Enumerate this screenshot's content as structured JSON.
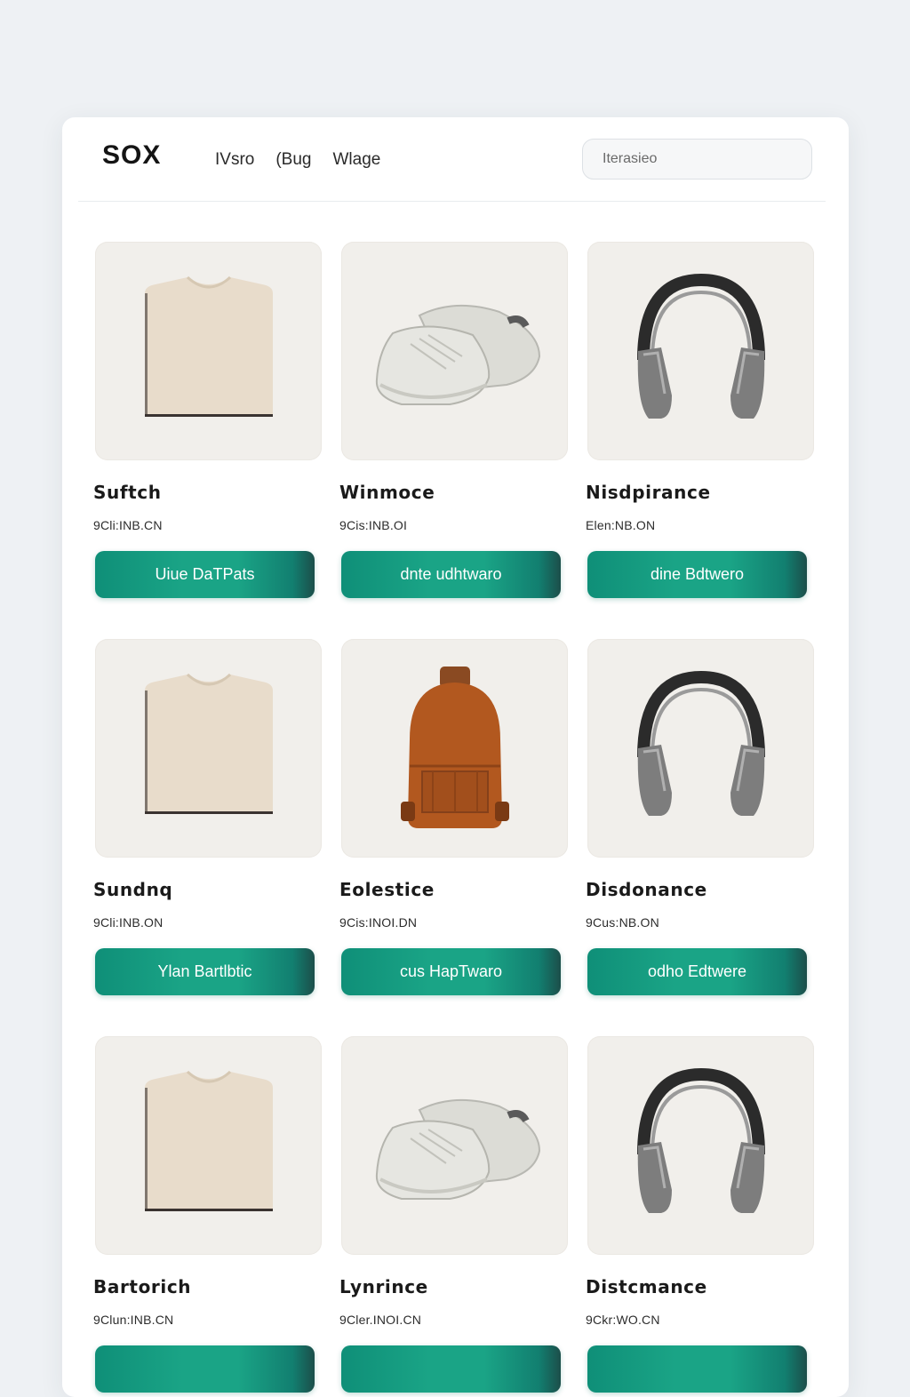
{
  "header": {
    "brand": "SOX",
    "nav": [
      "IVsro",
      "(Bug",
      "Wlage"
    ],
    "search_placeholder": "Iterasieo"
  },
  "products": [
    {
      "name": "Suftch",
      "price": "9Cli:INB.CN",
      "button": "Uiue DaTPats",
      "image": "tshirt-image"
    },
    {
      "name": "Winmoce",
      "price": "9Cis:INB.OI",
      "button": "dnte udhtwaro",
      "image": "sneakers-image"
    },
    {
      "name": "Nisdpirance",
      "price": "Elen:NB.ON",
      "button": "dine Bdtwero",
      "image": "headphones-image"
    },
    {
      "name": "Sundnq",
      "price": "9Cli:INB.ON",
      "button": "Ylan Bartlbtic",
      "image": "tshirt-image"
    },
    {
      "name": "Eolestice",
      "price": "9Cis:INOI.DN",
      "button": "cus HapTwaro",
      "image": "backpack-image"
    },
    {
      "name": "Disdonance",
      "price": "9Cus:NB.ON",
      "button": "odho Edtwere",
      "image": "headphones-image"
    },
    {
      "name": "Bartorich",
      "price": "9Clun:INB.CN",
      "button": "",
      "image": "tshirt-image"
    },
    {
      "name": "Lynrince",
      "price": "9Cler.INOI.CN",
      "button": "",
      "image": "sneakers-image"
    },
    {
      "name": "Distcmance",
      "price": "9Ckr:WO.CN",
      "button": "",
      "image": "headphones-image"
    }
  ],
  "colors": {
    "accent": "#1aa486",
    "accent_dark": "#1c4e4a",
    "photo_bg": "#f1efeb"
  }
}
